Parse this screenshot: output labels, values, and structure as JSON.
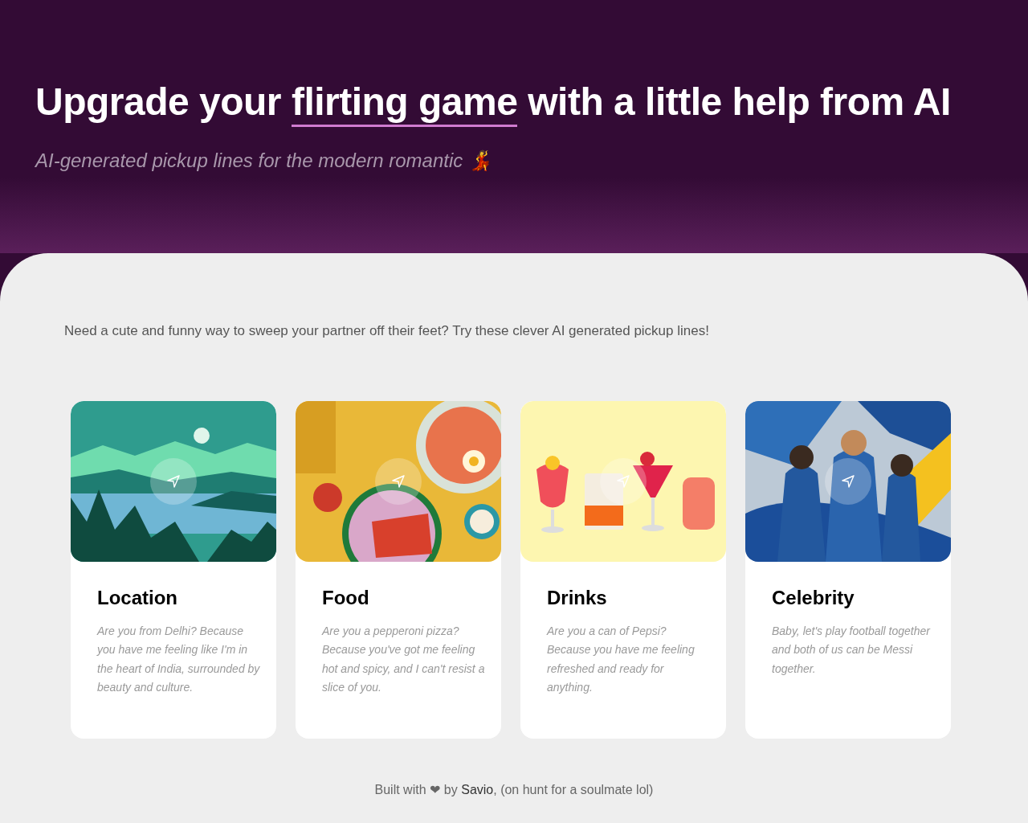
{
  "hero": {
    "heading_before": "Upgrade your",
    "heading_highlight": "flirting game",
    "heading_after": "with a little help from AI",
    "subtitle": "AI-generated pickup lines for the modern romantic 💃"
  },
  "intro": "Need a cute and funny way to sweep your partner off their feet? Try these clever AI generated pickup lines!",
  "cards": [
    {
      "kind": "landscape",
      "title": "Location",
      "line": "Are you from Delhi? Because you have me feeling like I'm in the heart of India, surrounded by beauty and culture."
    },
    {
      "kind": "food",
      "title": "Food",
      "line": "Are you a pepperoni pizza? Because you've got me feeling hot and spicy, and I can't resist a slice of you."
    },
    {
      "kind": "drinks",
      "title": "Drinks",
      "line": "Are you a can of Pepsi? Because you have me feeling refreshed and ready for anything."
    },
    {
      "kind": "sport",
      "title": "Celebrity",
      "line": "Baby, let's play football together and both of us can be Messi together."
    }
  ],
  "footer": {
    "before": "Built with ❤ by",
    "link": "Savio",
    "after": ", (on hunt for a soulmate lol)"
  }
}
